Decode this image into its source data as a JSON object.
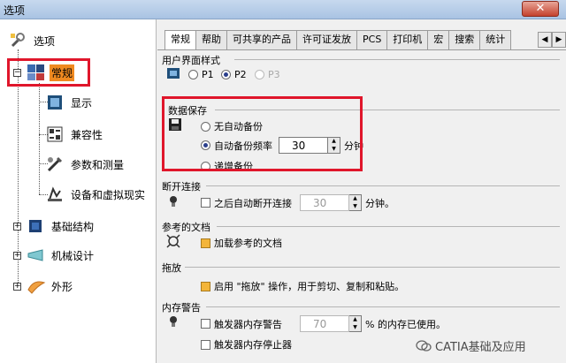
{
  "window": {
    "title": "选项",
    "close_glyph": "✕"
  },
  "tree": {
    "root": {
      "label": "选项",
      "icon": "options-icon"
    },
    "items": [
      {
        "label": "常规",
        "icon": "general-icon",
        "selected": true
      },
      {
        "label": "显示",
        "icon": "display-icon"
      },
      {
        "label": "兼容性",
        "icon": "compatibility-icon"
      },
      {
        "label": "参数和测量",
        "icon": "parameters-icon"
      },
      {
        "label": "设备和虚拟现实",
        "icon": "devices-icon"
      },
      {
        "label": "基础结构",
        "icon": "infrastructure-icon"
      },
      {
        "label": "机械设计",
        "icon": "mechanical-design-icon"
      },
      {
        "label": "外形",
        "icon": "shape-icon"
      }
    ]
  },
  "tabs": [
    {
      "label": "常规",
      "active": true
    },
    {
      "label": "帮助"
    },
    {
      "label": "可共享的产品"
    },
    {
      "label": "许可证发放"
    },
    {
      "label": "PCS"
    },
    {
      "label": "打印机"
    },
    {
      "label": "宏"
    },
    {
      "label": "搜索"
    },
    {
      "label": "统计"
    }
  ],
  "sections": {
    "ui_style": {
      "title": "用户界面样式",
      "options": [
        "P1",
        "P2",
        "P3"
      ],
      "selected": "P2"
    },
    "data_save": {
      "title": "数据保存",
      "opt_none": "无自动备份",
      "opt_auto": "自动备份频率",
      "auto_value": "30",
      "auto_unit": "分钟",
      "opt_incremental": "递增备份"
    },
    "disconnect": {
      "title": "断开连接",
      "label": "之后自动断开连接",
      "value": "30",
      "unit": "分钟。"
    },
    "ref_docs": {
      "title": "参考的文档",
      "label": "加载参考的文档"
    },
    "drag": {
      "title": "拖放",
      "label": "启用 \"拖放\" 操作，用于剪切、复制和粘贴。"
    },
    "memory": {
      "title": "内存警告",
      "warn_label": "触发器内存警告",
      "warn_value": "70",
      "warn_unit": "% 的内存已使用。",
      "stop_label": "触发器内存停止器"
    }
  },
  "watermark": "CATIA基础及应用",
  "colors": {
    "highlight_red": "#e0162b",
    "checked_orange": "#f3b53a"
  }
}
